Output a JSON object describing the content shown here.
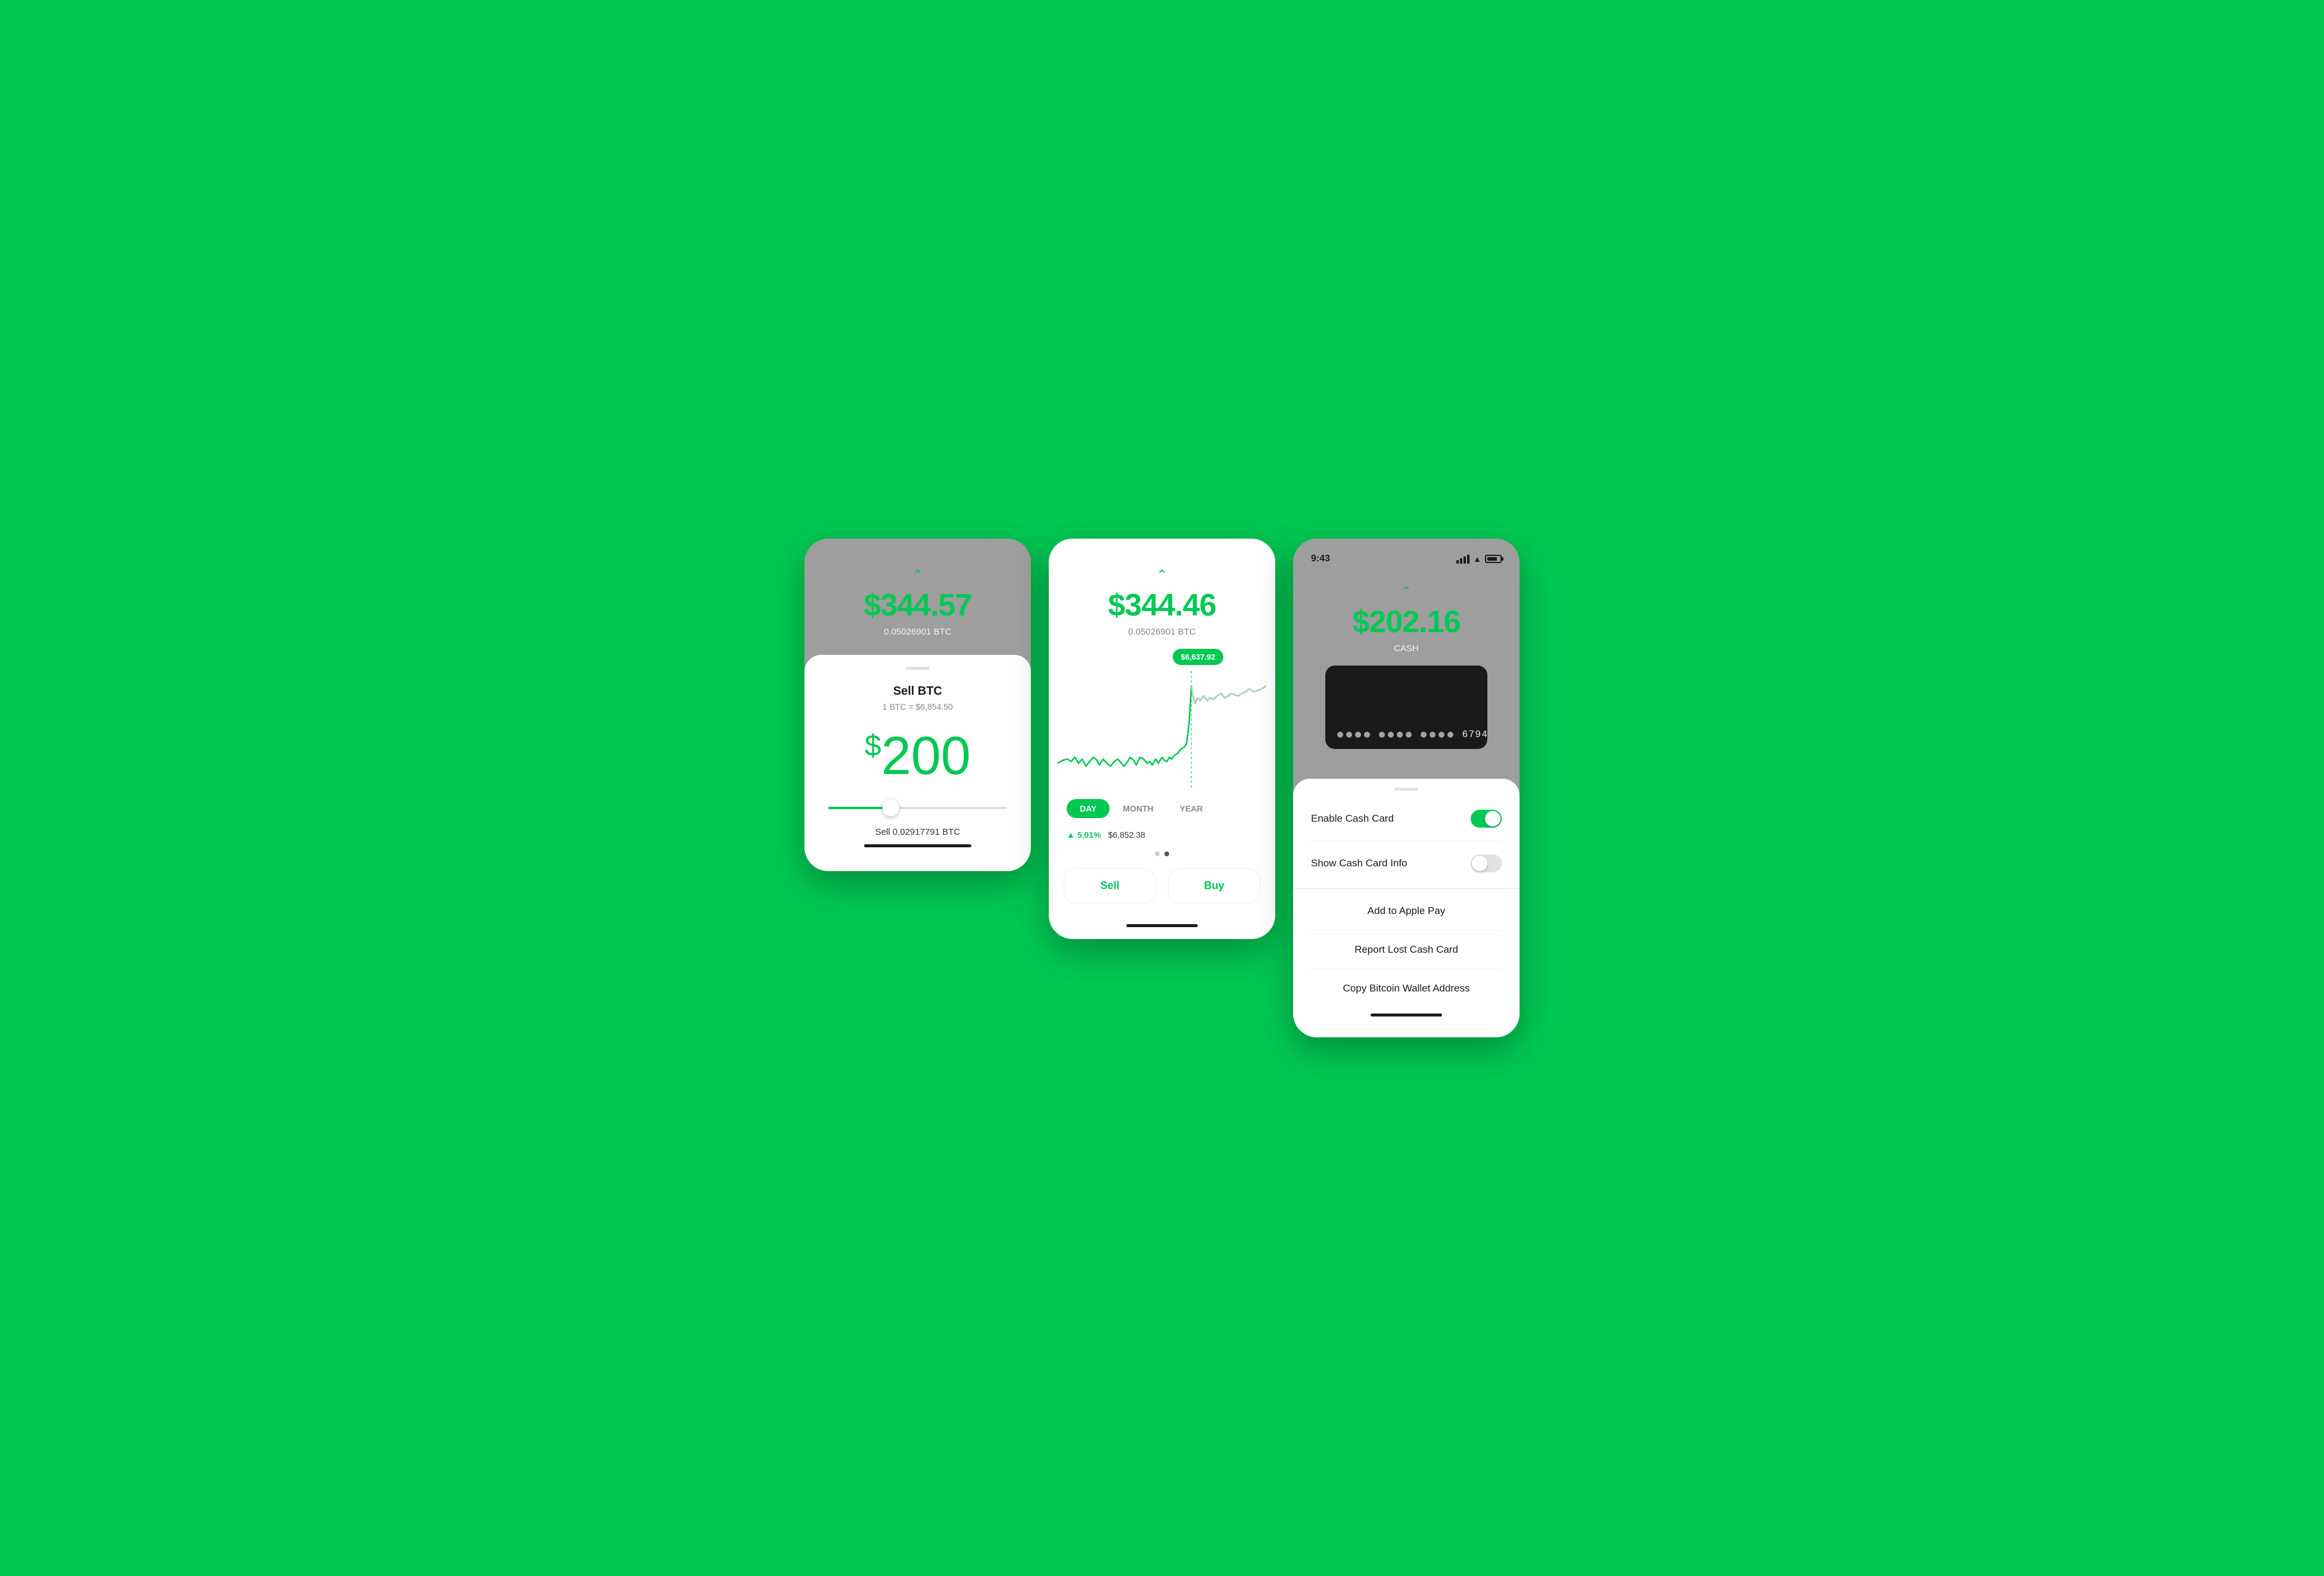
{
  "screen1": {
    "btc_value": "$344.57",
    "btc_amount": "0.05026901 BTC",
    "card_title": "Sell BTC",
    "exchange_rate": "1 BTC = $6,854.50",
    "sell_amount_dollar": "$",
    "sell_amount_number": "200",
    "sell_btc": "Sell 0.02917791 BTC"
  },
  "screen2": {
    "btc_value": "$344.46",
    "btc_amount": "0.05026901 BTC",
    "chart_bubble": "$6,637.92",
    "tab_day": "DAY",
    "tab_month": "MONTH",
    "tab_year": "YEAR",
    "stat_pct": "5.01%",
    "stat_price": "$6,852.38",
    "sell_btn": "Sell",
    "buy_btn": "Buy"
  },
  "screen3": {
    "status_time": "9:43",
    "cash_value": "$202.16",
    "cash_label": "CASH",
    "card_last4": "6794",
    "enable_cash_card": "Enable Cash Card",
    "show_cash_card_info": "Show Cash Card Info",
    "add_to_apple_pay": "Add to Apple Pay",
    "report_lost": "Report Lost Cash Card",
    "copy_bitcoin": "Copy Bitcoin Wallet Address"
  },
  "colors": {
    "green": "#00C853",
    "dark": "#1a1a1a",
    "gray": "#9E9E9E",
    "light_gray": "#E0E0E0"
  }
}
